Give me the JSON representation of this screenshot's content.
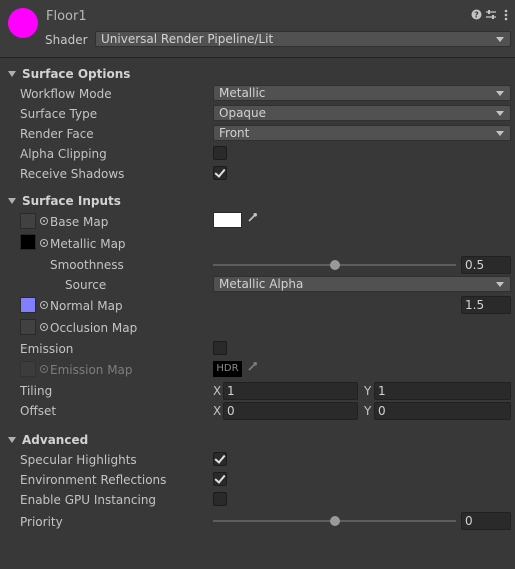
{
  "header": {
    "material_name": "Floor1",
    "material_color": "#ff00ff",
    "shader_label": "Shader",
    "shader_value": "Universal Render Pipeline/Lit",
    "icons": [
      "help-icon",
      "preset-icon",
      "menu-icon"
    ]
  },
  "surface_options": {
    "title": "Surface Options",
    "workflow_mode": {
      "label": "Workflow Mode",
      "value": "Metallic"
    },
    "surface_type": {
      "label": "Surface Type",
      "value": "Opaque"
    },
    "render_face": {
      "label": "Render Face",
      "value": "Front"
    },
    "alpha_clipping": {
      "label": "Alpha Clipping",
      "checked": false
    },
    "receive_shadows": {
      "label": "Receive Shadows",
      "checked": true
    }
  },
  "surface_inputs": {
    "title": "Surface Inputs",
    "base_map": {
      "label": "Base Map",
      "color": "#ffffff"
    },
    "metallic_map": {
      "label": "Metallic Map",
      "thumb_color": "#000000"
    },
    "smoothness": {
      "label": "Smoothness",
      "value": "0.5",
      "fraction": 0.5
    },
    "source": {
      "label": "Source",
      "value": "Metallic Alpha"
    },
    "normal_map": {
      "label": "Normal Map",
      "thumb_color": "#8080ff",
      "value": "1.5"
    },
    "occlusion_map": {
      "label": "Occlusion Map"
    },
    "emission": {
      "label": "Emission",
      "checked": false
    },
    "emission_map": {
      "label": "Emission Map",
      "hdr": "HDR"
    },
    "tiling": {
      "label": "Tiling",
      "x_label": "X",
      "x": "1",
      "y_label": "Y",
      "y": "1"
    },
    "offset": {
      "label": "Offset",
      "x_label": "X",
      "x": "0",
      "y_label": "Y",
      "y": "0"
    }
  },
  "advanced": {
    "title": "Advanced",
    "specular_highlights": {
      "label": "Specular Highlights",
      "checked": true
    },
    "environment_reflections": {
      "label": "Environment Reflections",
      "checked": true
    },
    "gpu_instancing": {
      "label": "Enable GPU Instancing",
      "checked": false
    },
    "priority": {
      "label": "Priority",
      "value": "0",
      "fraction": 0.5
    }
  }
}
